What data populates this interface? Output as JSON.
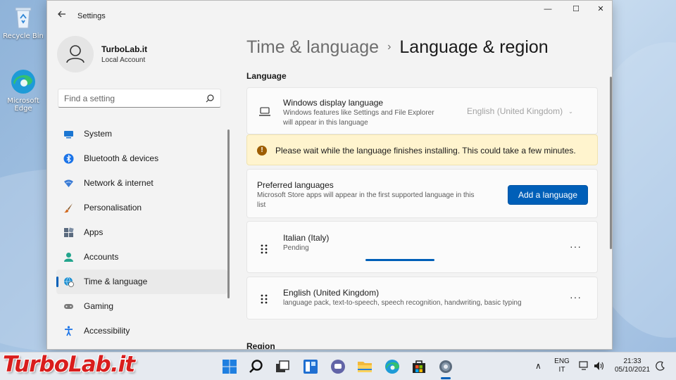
{
  "desktop": {
    "icons": [
      {
        "label_line1": "Recycle Bin",
        "label_line2": ""
      },
      {
        "label_line1": "Microsoft",
        "label_line2": "Edge"
      }
    ]
  },
  "window": {
    "title": "Settings",
    "controls": {
      "minimize": "—",
      "maximize": "☐",
      "close": "✕"
    }
  },
  "profile": {
    "name": "TurboLab.it",
    "account_type": "Local Account"
  },
  "search": {
    "placeholder": "Find a setting"
  },
  "sidebar": {
    "items": [
      {
        "label": "System",
        "icon": "system-icon",
        "color": "#1b76d2"
      },
      {
        "label": "Bluetooth & devices",
        "icon": "bluetooth-icon",
        "color": "#1a73e8"
      },
      {
        "label": "Network & internet",
        "icon": "wifi-icon",
        "color": "#3a7bd5"
      },
      {
        "label": "Personalisation",
        "icon": "brush-icon",
        "color": "#d2691e"
      },
      {
        "label": "Apps",
        "icon": "apps-icon",
        "color": "#5a6a7e"
      },
      {
        "label": "Accounts",
        "icon": "accounts-icon",
        "color": "#23a58d"
      },
      {
        "label": "Time & language",
        "icon": "globe-clock-icon",
        "color": "#1b8fd2"
      },
      {
        "label": "Gaming",
        "icon": "gamepad-icon",
        "color": "#7a7a7a"
      },
      {
        "label": "Accessibility",
        "icon": "accessibility-icon",
        "color": "#1a73e8"
      }
    ],
    "active_index": 6
  },
  "header": {
    "breadcrumb_parent": "Time & language",
    "separator": "›",
    "title": "Language & region"
  },
  "language": {
    "section_title": "Language",
    "display_language": {
      "title": "Windows display language",
      "description_line1": "Windows features like Settings and File Explorer",
      "description_line2": "will appear in this language",
      "selected": "English (United Kingdom)"
    },
    "banner": {
      "text": "Please wait while the language finishes installing. This could take a few minutes."
    },
    "preferred": {
      "title": "Preferred languages",
      "description_line1": "Microsoft Store apps will appear in the first supported language in this",
      "description_line2": "list",
      "button": "Add a language"
    },
    "list": [
      {
        "name": "Italian (Italy)",
        "status": "Pending",
        "progress": 0.5
      },
      {
        "name": "English (United Kingdom)",
        "status": "language pack, text-to-speech, speech recognition, handwriting, basic typing"
      }
    ],
    "more_glyph": "···"
  },
  "region": {
    "section_title": "Region"
  },
  "taskbar": {
    "apps": [
      "start-icon",
      "search-icon",
      "task-view-icon",
      "widgets-icon",
      "chat-icon",
      "file-explorer-icon",
      "edge-icon",
      "store-icon",
      "settings-icon"
    ],
    "tray": {
      "lang1": "ENG",
      "lang2": "IT",
      "time": "21:33",
      "date": "05/10/2021",
      "chevron": "∧"
    }
  },
  "watermark": {
    "text": "TurboLab.it"
  }
}
